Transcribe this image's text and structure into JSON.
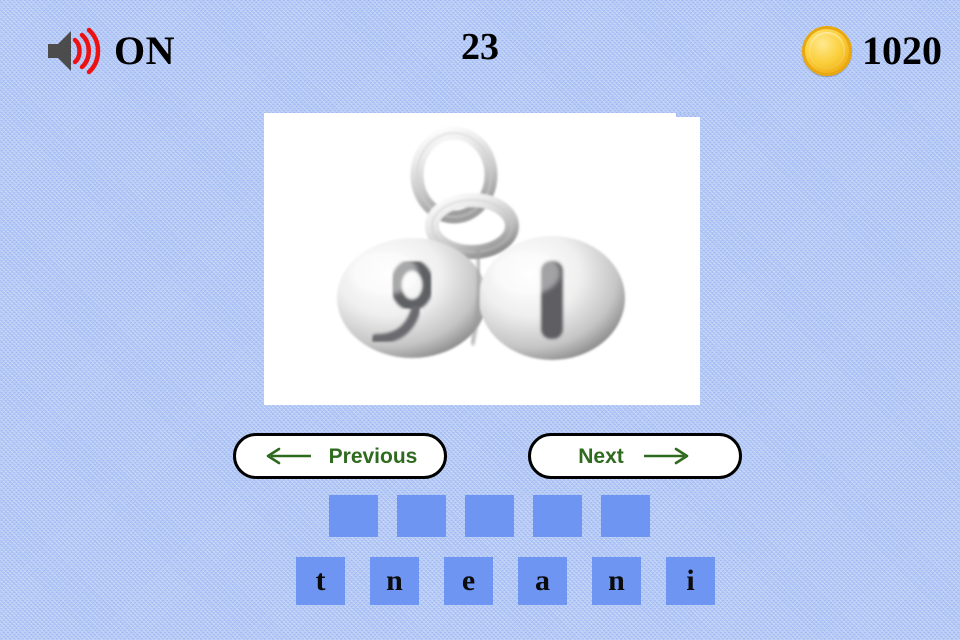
{
  "app": {
    "background_color": "#aec3f3"
  },
  "header": {
    "sound": {
      "icon": "speaker-sound-on-icon",
      "status_label": "ON",
      "speaker_color": "#4c4c4c",
      "wave_color": "#ee1111"
    },
    "level_counter": "23",
    "score": {
      "icon": "gold-coin-icon",
      "value": "1020",
      "coin_color": "#f2ae14"
    }
  },
  "picture": {
    "name": "puzzle-picture",
    "alt": "silver charm with two rounded bead letters on jump rings, white background",
    "background": "#ffffff"
  },
  "navigation": {
    "previous": {
      "label": "Previous",
      "arrow": "arrow-left-icon"
    },
    "next": {
      "label": "Next",
      "arrow": "arrow-right-icon"
    },
    "text_color": "#2f6b1e"
  },
  "puzzle": {
    "slot_count": 5,
    "slots": [
      "",
      "",
      "",
      "",
      ""
    ],
    "tiles": [
      "t",
      "n",
      "e",
      "a",
      "n",
      "i"
    ],
    "tile_color": "#6f95f2"
  }
}
